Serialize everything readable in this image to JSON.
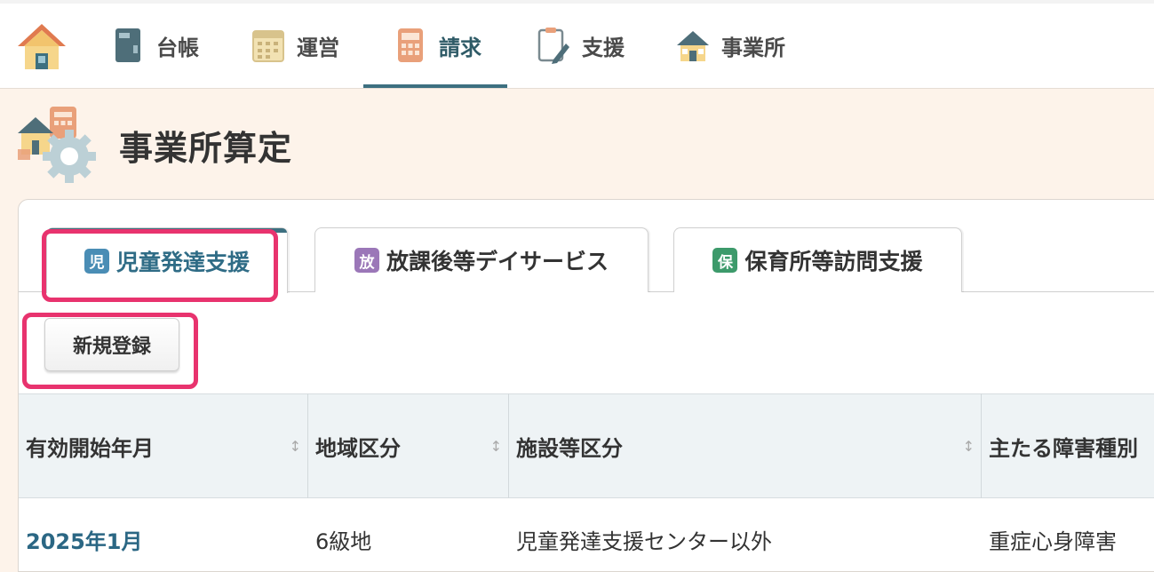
{
  "nav": {
    "items": [
      {
        "label": "台帳",
        "icon": "ledger-icon"
      },
      {
        "label": "運営",
        "icon": "calendar-icon"
      },
      {
        "label": "請求",
        "icon": "calculator-icon",
        "active": true
      },
      {
        "label": "支援",
        "icon": "clipboard-pencil-icon"
      },
      {
        "label": "事業所",
        "icon": "office-house-icon"
      }
    ]
  },
  "page": {
    "title": "事業所算定"
  },
  "tabs": [
    {
      "badge": "児",
      "label": "児童発達支援",
      "badge_color": "#4a8db5",
      "active": true
    },
    {
      "badge": "放",
      "label": "放課後等デイサービス",
      "badge_color": "#9b77b8"
    },
    {
      "badge": "保",
      "label": "保育所等訪問支援",
      "badge_color": "#3d9a6b"
    }
  ],
  "actions": {
    "new_label": "新規登録"
  },
  "table": {
    "columns": [
      "有効開始年月",
      "地域区分",
      "施設等区分",
      "主たる障害種別"
    ],
    "sort_glyph": "↕",
    "rows": [
      [
        "2025年1月",
        "6級地",
        "児童発達支援センター以外",
        "重症心身障害"
      ]
    ]
  },
  "colors": {
    "accent": "#3d7080",
    "highlight": "#e8336e",
    "background": "#fdf3ea"
  }
}
